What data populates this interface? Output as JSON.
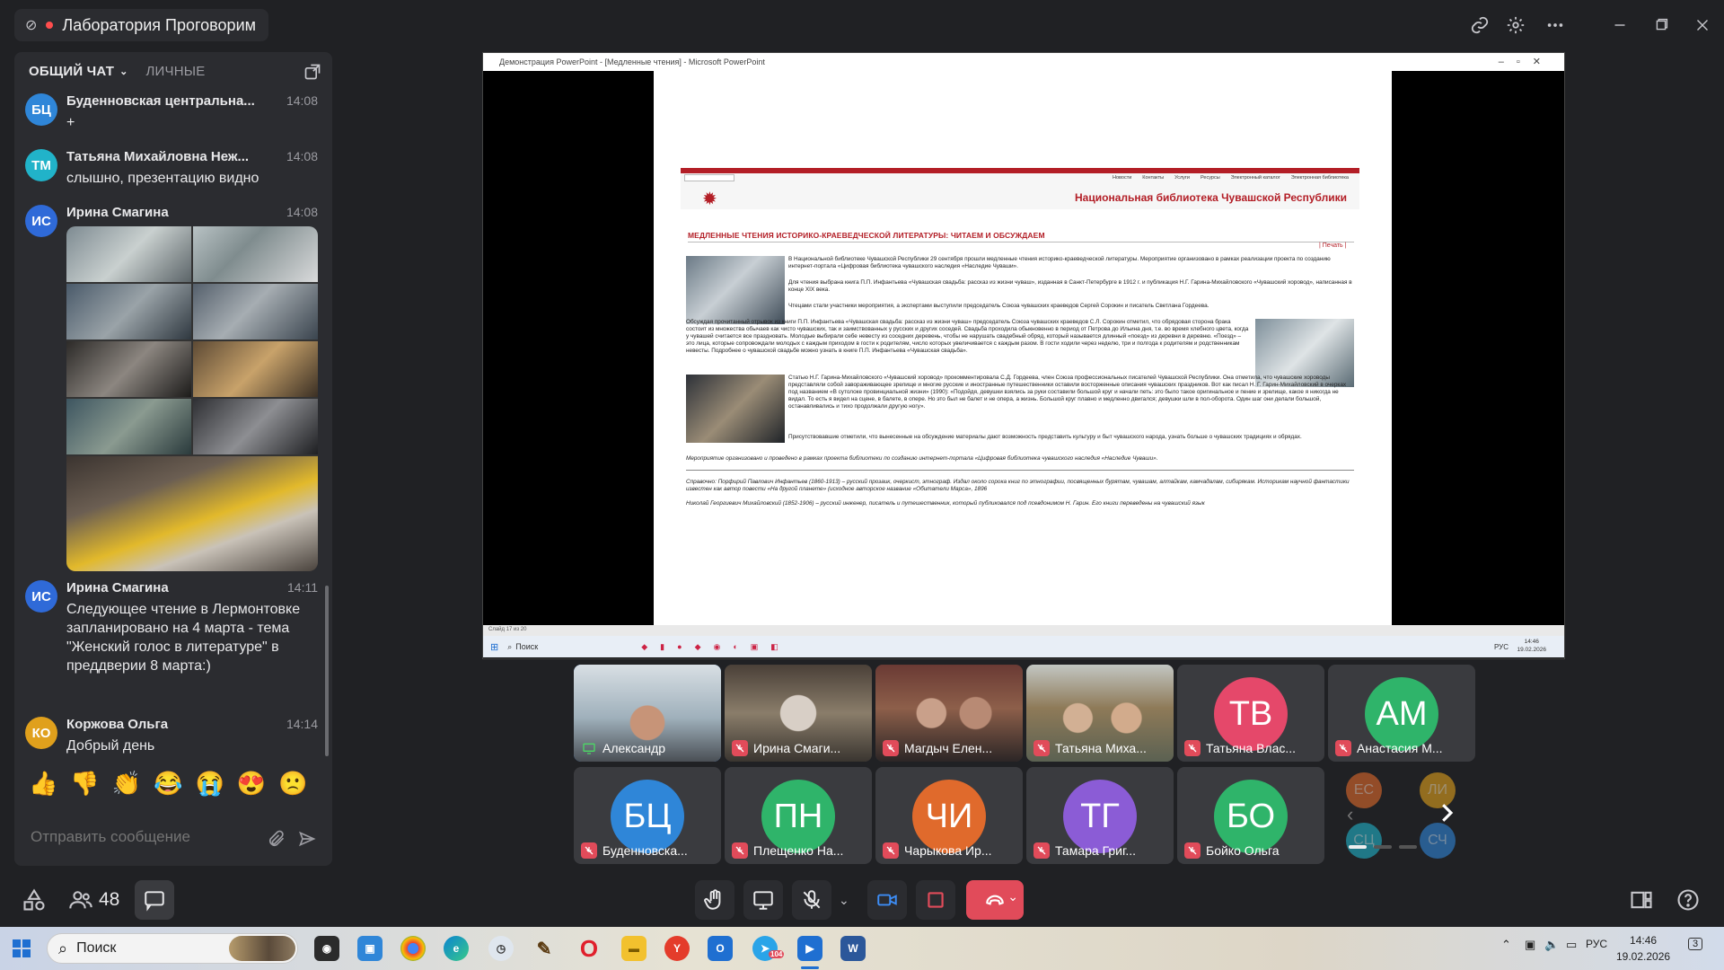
{
  "window": {
    "room_title": "Лаборатория Проговорим"
  },
  "chat": {
    "tabs": [
      {
        "label": "ОБЩИЙ ЧАТ"
      },
      {
        "label": "ЛИЧНЫЕ"
      }
    ],
    "messages": [
      {
        "initials": "БЦ",
        "author": "Буденновская центральна...",
        "time": "14:08",
        "text": "+",
        "avatar_color": "#2f86d8"
      },
      {
        "initials": "ТМ",
        "author": "Татьяна Михайловна Неж...",
        "time": "14:08",
        "text": "слышно, презентацию видно",
        "avatar_color": "#21b3c9"
      },
      {
        "initials": "ИС",
        "author": "Ирина Смагина",
        "time": "14:08",
        "text": "",
        "avatar_color": "#2f6ad8"
      },
      {
        "initials": "ИС",
        "author": "Ирина Смагина",
        "time": "14:11",
        "text": "Следующее чтение в Лермонтовке запланировано на 4 марта - тема \"Женский голос в литературе\" в преддверии 8 марта:)",
        "avatar_color": "#2f6ad8"
      },
      {
        "initials": "КО",
        "author": "Коржова Ольга",
        "time": "14:14",
        "text": "Добрый день",
        "avatar_color": "#e0a01c"
      }
    ],
    "reactions": [
      "👍",
      "👎",
      "👏",
      "😂",
      "😭",
      "😍",
      "🙁"
    ],
    "composer_placeholder": "Отправить сообщение"
  },
  "shared_screen": {
    "ppt_title": "Демонстрация PowerPoint - [Медленные чтения] - Microsoft PowerPoint",
    "site_title": "Национальная библиотека Чувашской Республики",
    "site_nav": [
      "Новости",
      "Контакты",
      "Услуги",
      "Ресурсы",
      "Электронный каталог",
      "Электронная библиотека"
    ],
    "article_title": "МЕДЛЕННЫЕ ЧТЕНИЯ ИСТОРИКО-КРАЕВЕДЧЕСКОЙ ЛИТЕРАТУРЫ: ЧИТАЕМ И ОБСУЖДАЕМ",
    "print_link": "| Печать |",
    "paragraphs": [
      "В Национальной библиотеке Чувашской Республики 29 сентября прошли медленные чтения историко-краеведческой литературы. Мероприятие организовано в рамках реализации проекта по созданию интернет-портала «Цифровая библиотека чувашского наследия «Наследие Чуваши».",
      "Для чтения выбрана книга П.П. Инфантьева «Чувашская свадьба: рассказ из жизни чуваш», изданная в Санкт-Петербурге в 1912 г. и публикация Н.Г. Гарина-Михайловского «Чувашский хоровод», написанная в конце XIX века.",
      "Чтецами стали участники мероприятия, а экспертами выступили председатель Союза чувашских краеведов Сергей Сорокин и писатель Светлана Гордеева.",
      "Обсуждая прочитанный отрывок из книги П.П. Инфантьева «Чувашская свадьба: рассказ из жизни чуваш» председатель Союза чувашских краеведов С.Л. Сорокин отметил, что обрядовая сторона брака состоит из множества обычаев как чисто чувашских, так и заимствованных у русских и других соседей. Свадьба проходила обыкновенно в период от Петрова до Ильина дня, т.е. во время хлебного цвета, когда у чувашей считается все праздновать. Молодые выбирали себе невесту из соседних деревень, чтобы не нарушать свадебный обряд, который называется длинный «поезд» из деревни в деревню. «Поезд» – это лица, которые сопровождали молодых с каждым приходом в гости к родителям, число которых увеличивается с каждым разом. В гости ходили через неделю, три и полгода к родителям и родственникам невесты. Подробнее о чувашской свадьбе можно узнать в книге П.П. Инфантьева «Чувашская свадьба».",
      "Статью Н.Г. Гарина-Михайловского «Чувашский хоровод» прокомментировала С.Д. Гордеева, член Союза профессиональных писателей Чувашской Республики. Она отметила, что чувашские хороводы представляли собой завораживающее зрелище и многие русские и иностранные путешественники оставили восторженные описания чувашских праздников. Вот как писал Н. Г. Гарин-Михайловский в очерках под названием «В сутолоке провинциальной жизни» (1990): «Подойдя, девушки взялись за руки составили большой круг и начали петь: это было такое оригинальное и пение и зрелище, какое я никогда не видал. То есть я видел на сцене, в балете, в опере. Но это был не балет и не опера, а жизнь. Большой круг плавно и медленно двигался; девушки шли в пол-оборота. Один шаг они делали большой, останавливались и тихо продолжали другую ногу».",
      "Присутствовавшие отметили, что вынесенные на обсуждение материалы дают возможность представить культуру и быт чувашского народа, узнать больше о чувашских традициях и обрядах.",
      "Мероприятие организовано и проведено в рамках проекта библиотеки по созданию интернет-портала «Цифровая библиотека чувашского наследия «Наследие Чуваши».",
      "Справочно: Порфирий Павлович Инфантьев (1860-1913) – русский прозаик, очеркист, этнограф. Издал около сорока книг по этнографии, посвященных бурятам, чувашам, алтайкам, камчадалам, сибирякам. Историкам научной фантастики известен как автор повести «На другой планете» (исходное авторское название «Обитатели Марса», 1896",
      "Николай Георгиевич Михайловский (1852-1906) – русский инженер, писатель и путешественник, который публиковался под псевдонимом Н. Гарин. Его книги переведены на чувашский язык"
    ],
    "status_bar": "Слайд 17 из 20",
    "win_search": "Поиск",
    "win_clock_time": "14:46",
    "win_clock_date": "19.02.2026",
    "win_lang": "РУС"
  },
  "participants": [
    {
      "name": "Александр",
      "type": "video",
      "muted": false,
      "sharing": true
    },
    {
      "name": "Ирина Смаги...",
      "type": "video",
      "muted": true
    },
    {
      "name": "Магдыч Елен...",
      "type": "video",
      "muted": true
    },
    {
      "name": "Татьяна Миха...",
      "type": "video",
      "muted": true
    },
    {
      "name": "Татьяна Влас...",
      "initials": "ТВ",
      "type": "avatar",
      "muted": true,
      "color": "#e5486a"
    },
    {
      "name": "Анастасия М...",
      "initials": "АМ",
      "type": "avatar",
      "muted": true,
      "color": "#2fb46a"
    },
    {
      "name": "Буденновска...",
      "initials": "БЦ",
      "type": "avatar",
      "muted": true,
      "color": "#2f86d8"
    },
    {
      "name": "Плещенко На...",
      "initials": "ПН",
      "type": "avatar",
      "muted": true,
      "color": "#2fb46a"
    },
    {
      "name": "Чарыкова Ир...",
      "initials": "ЧИ",
      "type": "avatar",
      "muted": true,
      "color": "#e06a2c"
    },
    {
      "name": "Тамара Григ...",
      "initials": "ТГ",
      "type": "avatar",
      "muted": true,
      "color": "#8b5cd6"
    },
    {
      "name": "Бойко Ольга",
      "initials": "БО",
      "type": "avatar",
      "muted": true,
      "color": "#2fb46a"
    }
  ],
  "overflow_avatars": [
    {
      "initials": "ЕС",
      "color": "#e06a2c"
    },
    {
      "initials": "ЛИ",
      "color": "#e0a01c"
    },
    {
      "initials": "СЦ",
      "color": "#21b3c9"
    },
    {
      "initials": "СЧ",
      "color": "#2f86d8"
    }
  ],
  "toolbar": {
    "participants_count": "48"
  },
  "taskbar": {
    "search_label": "Поиск",
    "lang": "РУС",
    "time": "14:46",
    "date": "19.02.2026",
    "notification_count": "3",
    "mail_badge": "104"
  }
}
